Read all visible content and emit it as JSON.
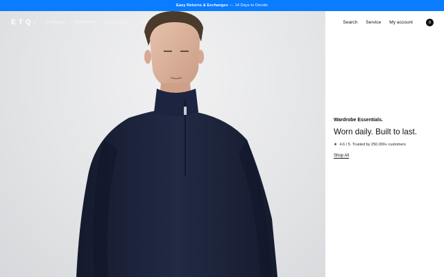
{
  "announcement": {
    "bold": "Easy Returns & Exchanges",
    "separator": "—",
    "rest": "14 Days to Decide"
  },
  "header": {
    "logo": "ETQ.",
    "nav_left": [
      "Footwear",
      "Menswear",
      "Accessories",
      "Sale"
    ],
    "nav_right": [
      "Search",
      "Service",
      "My account"
    ],
    "cart_count": "0"
  },
  "hero": {
    "eyebrow": "Wardrobe Essentials.",
    "headline": "Worn daily. Built to last.",
    "rating_star": "★",
    "rating_text": "4.6 / 5. Trusted by 250.000+ customers",
    "cta": "Shop All",
    "image_subject": "model-in-navy-half-zip-sweater"
  },
  "colors": {
    "announcement_bg": "#0a7cff",
    "sweater": "#1c2238",
    "background": "#e4e5e7"
  }
}
